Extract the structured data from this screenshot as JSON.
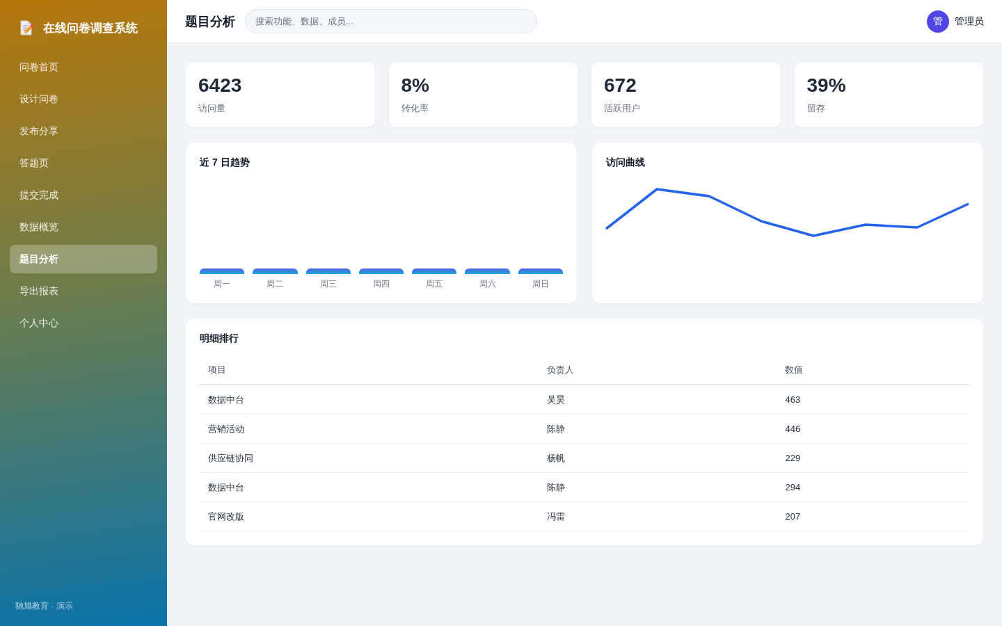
{
  "sidebar": {
    "brand": "在线问卷调查系统",
    "items": [
      {
        "label": "问卷首页",
        "selected": false
      },
      {
        "label": "设计问卷",
        "selected": false
      },
      {
        "label": "发布分享",
        "selected": false
      },
      {
        "label": "答题页",
        "selected": false
      },
      {
        "label": "提交完成",
        "selected": false
      },
      {
        "label": "数据概览",
        "selected": false
      },
      {
        "label": "题目分析",
        "selected": true
      },
      {
        "label": "导出报表",
        "selected": false
      },
      {
        "label": "个人中心",
        "selected": false
      }
    ],
    "footer": "驰旭教育 · 演示"
  },
  "header": {
    "title": "题目分析",
    "search": {
      "placeholder": "搜索功能、数据、成员..."
    },
    "user": {
      "avatar": "管",
      "name": "管理员"
    }
  },
  "stats": [
    {
      "value": "6423",
      "label": "访问量"
    },
    {
      "value": "8%",
      "label": "转化率"
    },
    {
      "value": "672",
      "label": "活跃用户"
    },
    {
      "value": "39%",
      "label": "留存"
    }
  ],
  "bar_card": {
    "title": "近 7 日趋势",
    "day_labels": [
      "周一",
      "周二",
      "周三",
      "周四",
      "周五",
      "周六",
      "周日"
    ]
  },
  "line_card": {
    "title": "访问曲线"
  },
  "table": {
    "title": "明细排行",
    "columns": [
      "项目",
      "负责人",
      "数值"
    ],
    "rows": [
      [
        "数据中台",
        "吴昊",
        "463"
      ],
      [
        "营销活动",
        "陈静",
        "446"
      ],
      [
        "供应链协同",
        "杨帆",
        "229"
      ],
      [
        "数据中台",
        "陈静",
        "294"
      ],
      [
        "官网改版",
        "冯雷",
        "207"
      ]
    ]
  }
}
